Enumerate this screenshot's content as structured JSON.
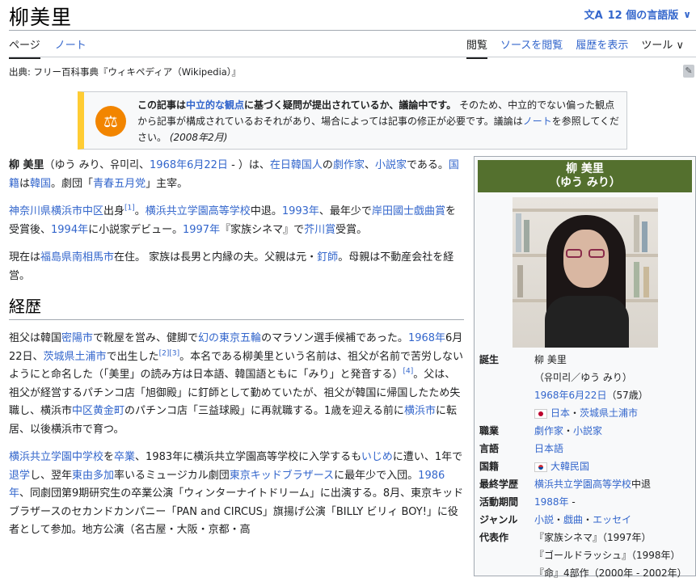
{
  "header": {
    "title": "柳美里",
    "lang_glyph": "文A",
    "lang_label": "12 個の言語版",
    "lang_chevron": "∨"
  },
  "tabs_left": [
    "ページ",
    "ノート"
  ],
  "tabs_right": [
    "閲覧",
    "ソースを閲覧",
    "履歴を表示",
    "ツール"
  ],
  "tools_chevron": "∨",
  "source": "出典: フリー百科事典『ウィキペディア（Wikipedia）』",
  "side_icon": "✎",
  "notice": {
    "icon": "⚖",
    "bold1": "この記事は",
    "link1": "中立的な観点",
    "bold2": "に基づく疑問が提出されているか、議論中です。",
    "text1": "そのため、中立的でない偏った観点から記事が構成されているおそれがあり、場合によっては記事の修正が必要です。議論は",
    "link2": "ノート",
    "text2": "を参照してください。",
    "date": "(2008年2月)"
  },
  "para1": {
    "name": "柳 美里",
    "t1": "（ゆう みり、유미리、",
    "d1": "1968年6月22日",
    "t2": " - ）は、",
    "l1": "在日韓国人",
    "t3": "の",
    "l2": "劇作家",
    "t4": "、",
    "l3": "小説家",
    "t5": "である。",
    "l4": "国籍",
    "t6": "は",
    "l5": "韓国",
    "t7": "。劇団「",
    "l6": "青春五月党",
    "t8": "」主宰。"
  },
  "para2": {
    "l1": "神奈川県横浜市中区",
    "t1": "出身",
    "r1": "[1]",
    "t2": "。",
    "l2": "横浜共立学園高等学校",
    "t3": "中退。",
    "l3": "1993年",
    "t4": "、最年少で",
    "l4": "岸田國士戯曲賞",
    "t5": "を受賞後、",
    "l5": "1994年",
    "t6": "に小説家デビュー。",
    "l6": "1997年",
    "t7": "『家族シネマ』で",
    "l7": "芥川賞",
    "t8": "受賞。"
  },
  "para3": {
    "t1": "現在は",
    "l1": "福島県南相馬市",
    "t2": "在住。 家族は長男と内縁の夫。父親は元・",
    "l2": "釘師",
    "t3": "。母親は不動産会社を経営。"
  },
  "section_title": "経歴",
  "para4": {
    "t1": "祖父は韓国",
    "l1": "密陽市",
    "t2": "で靴屋を営み、健脚で",
    "l2": "幻の東京五輪",
    "t3": "のマラソン選手候補であった。",
    "l3": "1968年",
    "t4": "6月22日、",
    "l4": "茨城県土浦市",
    "t5": "で出生した",
    "r1": "[2]",
    "r2": "[3]",
    "t6": "。本名である柳美里という名前は、祖父が名前で苦労しないようにと命名した（「美里」の読み方は日本語、韓国語ともに「みり」と発音する）",
    "r3": "[4]",
    "t7": "。父は、祖父が経営するパチンコ店「旭御殿」に釘師として勤めていたが、祖父が韓国に帰国したため失職し、横浜市",
    "l5": "中区",
    "l6": "黄金町",
    "t8": "のパチンコ店「三益球殿」に再就職する。1歳を迎える前に",
    "l7": "横浜市",
    "t9": "に転居、以後横浜市で育つ。"
  },
  "para5": {
    "l1": "横浜共立学園中学校",
    "t1": "を",
    "l2": "卒業",
    "t2": "、1983年に横浜共立学園高等学校に入学するも",
    "l3": "いじめ",
    "t3": "に遭い、1年で",
    "l4": "退学",
    "t4": "し、翌年",
    "l5": "東由多加",
    "t5": "率いるミュージカル劇団",
    "l6": "東京キッドブラザース",
    "t6": "に最年少で入団。",
    "l7": "1986年",
    "t7": "、同劇団第9期研究生の卒業公演「ウィンターナイトドリーム」に出演する。8月、東京キッドブラザースのセカンドカンパニー「PAN and CIRCUS」旗揚げ公演「BILLY ビリィ BOY!」に役者として参加。地方公演（名古屋・大阪・京都・高"
  },
  "infobox": {
    "name": "柳 美里",
    "reading": "（ゆう みり）",
    "rows": {
      "birth_label": "誕生",
      "birth_name": "柳 美里",
      "birth_reading": "（유미리／ゆう みり）",
      "birth_date": "1968年6月22日",
      "birth_age": "（57歳）",
      "birth_place1": "日本",
      "birth_sep": "・",
      "birth_place2": "茨城県土浦市",
      "job_label": "職業",
      "job1": "劇作家",
      "job_sep": "・",
      "job2": "小説家",
      "lang_label": "言語",
      "lang_val": "日本語",
      "nat_label": "国籍",
      "nat_val": "大韓民国",
      "edu_label": "最終学歴",
      "edu_link": "横浜共立学園高等学校",
      "edu_text": "中退",
      "period_label": "活動期間",
      "period_link": "1988年",
      "period_text": " -",
      "genre_label": "ジャンル",
      "genre1": "小説",
      "genre_sep1": "・",
      "genre2": "戯曲",
      "genre_sep2": "・",
      "genre3": "エッセイ",
      "works_label": "代表作",
      "work1": "『家族シネマ』（1997年）",
      "work2": "『ゴールドラッシュ』（1998年）",
      "work3": "『命』4部作（2000年 - 2002年）"
    }
  }
}
